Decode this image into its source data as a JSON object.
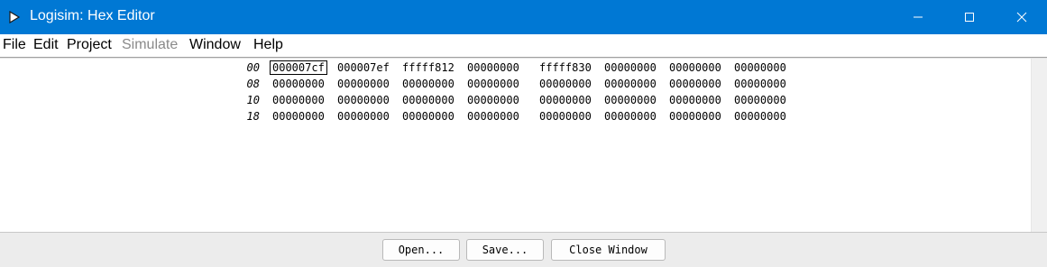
{
  "window": {
    "title": "Logisim: Hex Editor",
    "accent_color": "#0078d4",
    "icons": [
      "logisim-app-icon",
      "minimize-icon",
      "maximize-icon",
      "close-icon"
    ]
  },
  "menu": {
    "file": "File",
    "edit": "Edit",
    "project": "Project",
    "simulate": "Simulate",
    "window": "Window",
    "help": "Help"
  },
  "hex": {
    "rows": [
      {
        "address": "00",
        "cells": [
          "000007cf",
          "000007ef",
          "fffff812",
          "00000000",
          "fffff830",
          "00000000",
          "00000000",
          "00000000"
        ]
      },
      {
        "address": "08",
        "cells": [
          "00000000",
          "00000000",
          "00000000",
          "00000000",
          "00000000",
          "00000000",
          "00000000",
          "00000000"
        ]
      },
      {
        "address": "10",
        "cells": [
          "00000000",
          "00000000",
          "00000000",
          "00000000",
          "00000000",
          "00000000",
          "00000000",
          "00000000"
        ]
      },
      {
        "address": "18",
        "cells": [
          "00000000",
          "00000000",
          "00000000",
          "00000000",
          "00000000",
          "00000000",
          "00000000",
          "00000000"
        ]
      }
    ],
    "selected_cell": "000007cf"
  },
  "buttons": {
    "open": "Open...",
    "save": "Save...",
    "close": "Close Window"
  }
}
